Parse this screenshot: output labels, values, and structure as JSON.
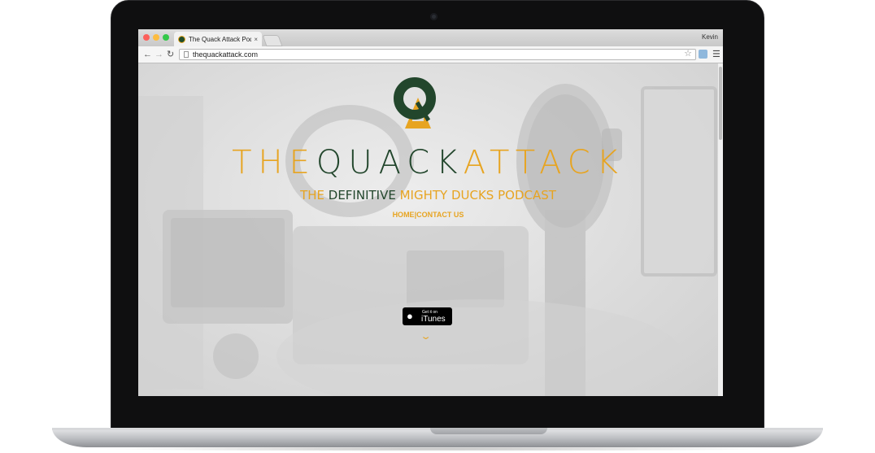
{
  "browser": {
    "tab_title": "The Quack Attack Podcast",
    "tab_close": "×",
    "user_name": "Kevin",
    "url": "thequackattack.com"
  },
  "hero": {
    "logo_letters": "QA",
    "brand": {
      "the": "THE",
      "quack": "QUACK",
      "attack": "ATTACK"
    },
    "tagline": {
      "the": "THE",
      "definitive": "DEFINITIVE",
      "mighty_ducks_podcast": "MIGHTY DUCKS PODCAST"
    },
    "nav": {
      "home": "HOME",
      "separator": "|",
      "contact": "CONTACT US"
    },
    "itunes_badge": {
      "top_text": "Get it on",
      "main_text": "iTunes"
    },
    "scroll_icon": "chevron-down-icon"
  },
  "colors": {
    "gold": "#e7a421",
    "green": "#22462c"
  }
}
